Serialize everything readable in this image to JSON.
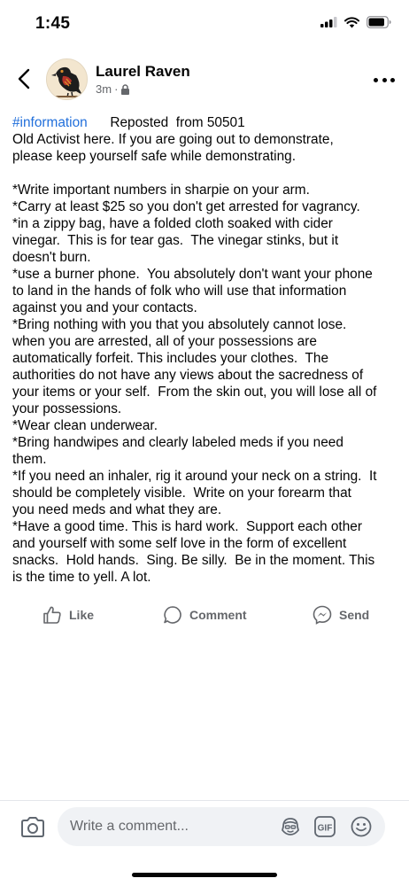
{
  "status_bar": {
    "time": "1:45"
  },
  "header": {
    "author": "Laurel Raven",
    "timestamp": "3m",
    "separator": "·"
  },
  "post": {
    "hashtag": "#information",
    "repost_note": "Reposted  from 50501",
    "lines": [
      "Old Activist here. If you are going out to demonstrate,",
      "please keep yourself safe while demonstrating.",
      "",
      "*Write important numbers in sharpie on your arm.",
      "*Carry at least $25 so you don't get arrested for vagrancy.",
      "*in a zippy bag, have a folded cloth soaked with cider",
      "vinegar.  This is for tear gas.  The vinegar stinks, but it",
      "doesn't burn.",
      "*use a burner phone.  You absolutely don't want your phone",
      "to land in the hands of folk who will use that information",
      "against you and your contacts.",
      "*Bring nothing with you that you absolutely cannot lose.",
      "when you are arrested, all of your possessions are",
      "automatically forfeit. This includes your clothes.  The",
      "authorities do not have any views about the sacredness of",
      "your items or your self.  From the skin out, you will lose all of",
      "your possessions.",
      "*Wear clean underwear.",
      "*Bring handwipes and clearly labeled meds if you need",
      "them.",
      "*If you need an inhaler, rig it around your neck on a string.  It",
      "should be completely visible.  Write on your forearm that",
      "you need meds and what they are.",
      "*Have a good time. This is hard work.  Support each other",
      "and yourself with some self love in the form of excellent",
      "snacks.  Hold hands.  Sing. Be silly.  Be in the moment. This",
      "is the time to yell. A lot."
    ]
  },
  "actions": {
    "like": "Like",
    "comment": "Comment",
    "send": "Send"
  },
  "composer": {
    "placeholder": "Write a comment..."
  },
  "icons": {
    "back": "chevron-left-icon",
    "privacy": "lock-icon",
    "more": "more-horizontal-icon",
    "like": "thumbs-up-icon",
    "comment": "speech-bubble-icon",
    "send": "messenger-icon",
    "camera": "camera-icon",
    "avatar_sticker": "avatar-sticker-icon",
    "gif": "gif-icon",
    "emoji": "smiley-icon"
  },
  "colors": {
    "hashtag": "#216fdb",
    "secondary_text": "#65676b",
    "composer_bg": "#f0f2f5"
  }
}
